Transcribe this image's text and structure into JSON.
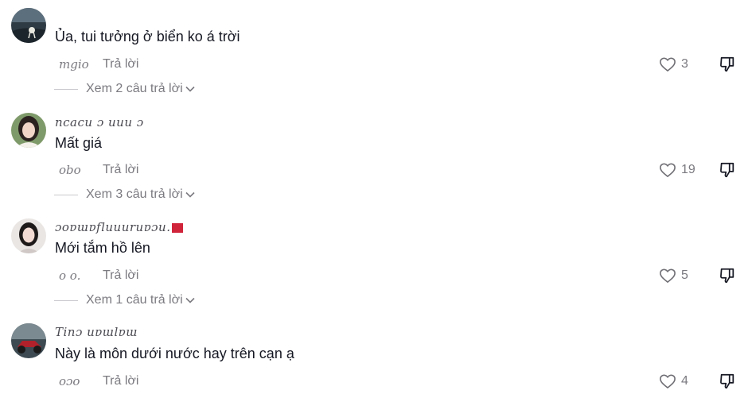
{
  "comments": [
    {
      "username": "",
      "text": "Ủa, tui tưởng ở biển ko á trời",
      "date": "mgio",
      "reply_label": "Trả lời",
      "likes": "3",
      "view_replies": "Xem 2 câu trả lời"
    },
    {
      "username": "ncacu ɔ uuu ɔ",
      "text": "Mất giá",
      "date": "obo",
      "reply_label": "Trả lời",
      "likes": "19",
      "view_replies": "Xem 3 câu trả lời"
    },
    {
      "username": "ɔoɐɯɐfluuuruɐɔu.",
      "text": "Mới tắm hồ lên",
      "date": "o o.",
      "reply_label": "Trả lời",
      "likes": "5",
      "view_replies": "Xem 1 câu trả lời"
    },
    {
      "username": "Tinɔ     uɐɯlɐɯ",
      "text": "Này là môn dưới nước hay trên cạn ạ",
      "date": "oɔo",
      "reply_label": "Trả lời",
      "likes": "4",
      "view_replies": ""
    }
  ],
  "colors": {
    "text": "#161823",
    "muted": "#7a7a80",
    "accent_red": "#d0243a"
  },
  "icons": {
    "like": "heart-outline-icon",
    "dislike": "thumbs-down-icon",
    "expand": "chevron-down-icon"
  }
}
